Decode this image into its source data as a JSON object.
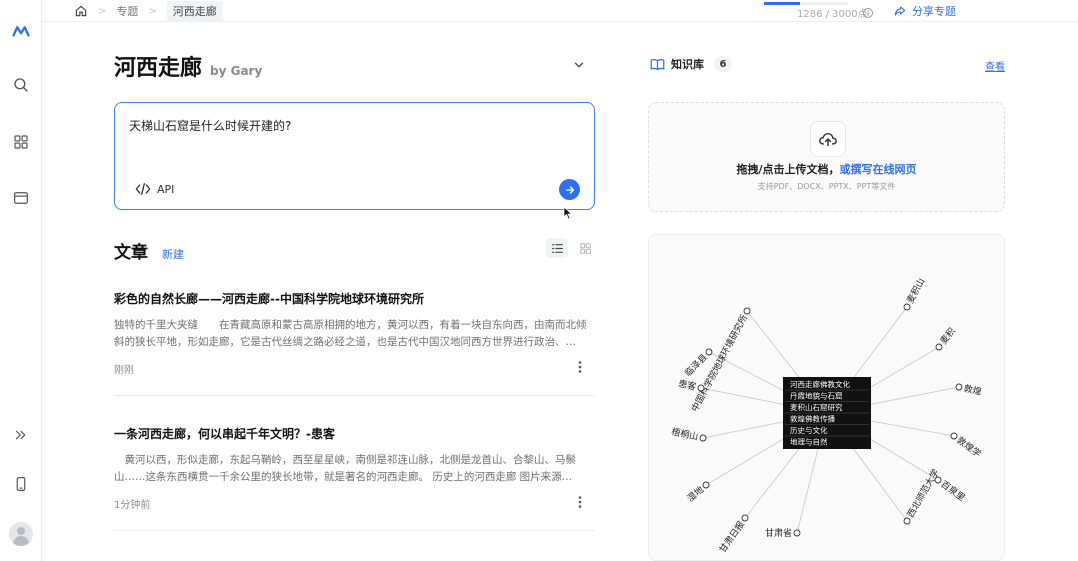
{
  "breadcrumb": {
    "topics": "专题",
    "current": "河西走廊"
  },
  "usage": {
    "text": "1286 / 3000点",
    "progress": 0.43
  },
  "share_label": "分享专题",
  "topic": {
    "title": "河西走廊",
    "author": "by Gary"
  },
  "question": {
    "value": "天梯山石窟是什么时候开建的?",
    "api_label": "API"
  },
  "articles_section": {
    "title": "文章",
    "new_label": "新建"
  },
  "articles": [
    {
      "title": "彩色的自然长廊——河西走廊--中国科学院地球环境研究所",
      "excerpt": "独特的千里大夹缝　　在青藏高原和蒙古高原相拥的地方，黄河以西，有着一块自东向西，由南而北倾斜的狭长平地，形如走廊，它是古代丝绸之路必经之道，也是古代中国汉地同西方世界进行政治、…",
      "time": "刚刚"
    },
    {
      "title": "一条河西走廊，何以串起千年文明？-患客",
      "excerpt": "　黄河以西，形似走廊，东起乌鞘岭，西至星星峡，南侧是祁连山脉，北侧是龙首山、合黎山、马鬃山……这条东西横贯一千余公里的狭长地带，就是著名的河西走廊。 历史上的河西走廊 图片来源…",
      "time": "1分钟前"
    }
  ],
  "knowledge_base": {
    "title": "知识库",
    "count": "6",
    "view_label": "查看"
  },
  "upload": {
    "main_text": "拖拽/点击上传文档，",
    "link_text": "或撰写在线网页",
    "sub_text": "支持PDF、DOCX、PPTX、PPT等文件"
  },
  "graph": {
    "center_items": [
      "河西走廊佛教文化",
      "丹霞地貌与石窟",
      "麦积山石窟研究",
      "敦煌佛教传播",
      "历史与文化",
      "地理与自然"
    ],
    "nodes": [
      "中国科学院地球环境研究所",
      "临泽县",
      "患客",
      "梧桐山",
      "湿地",
      "甘肃日报",
      "麦积山",
      "麦积",
      "敦煌",
      "敦煌学",
      "百泉里",
      "西北师范大学",
      "甘肃省"
    ]
  },
  "colors": {
    "accent": "#2f6fea",
    "border_focus": "#3b7cf0"
  }
}
